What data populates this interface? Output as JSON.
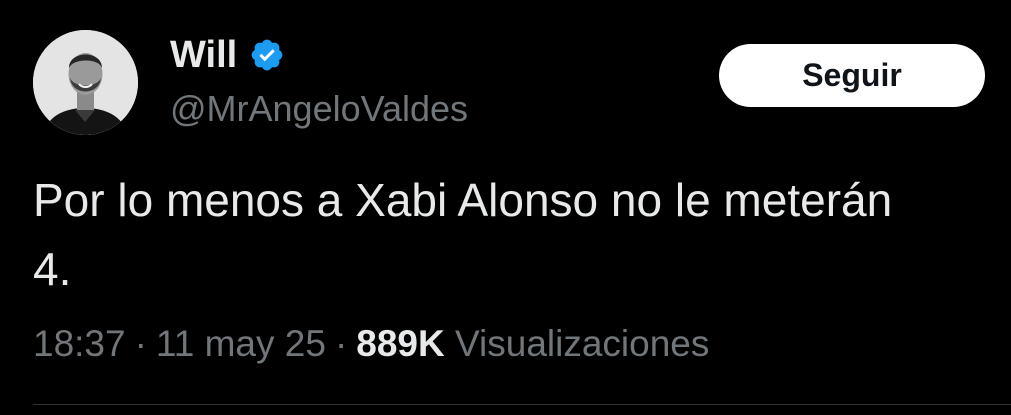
{
  "author": {
    "name": "Will",
    "handle": "@MrAngeloValdes",
    "verified": true,
    "verified_color": "#1d9bf0"
  },
  "follow_button": {
    "label": "Seguir"
  },
  "tweet": {
    "text": "Por lo menos a Xabi Alonso no le meterán 4.",
    "time": "18:37",
    "separator": "·",
    "date": "11 may 25",
    "views_count": "889K",
    "views_label": "Visualizaciones"
  },
  "colors": {
    "background": "#000000",
    "primary_text": "#e7e9ea",
    "secondary_text": "#71767b",
    "button_bg": "#ffffff",
    "button_text": "#0f1419",
    "divider": "#2f3336"
  }
}
